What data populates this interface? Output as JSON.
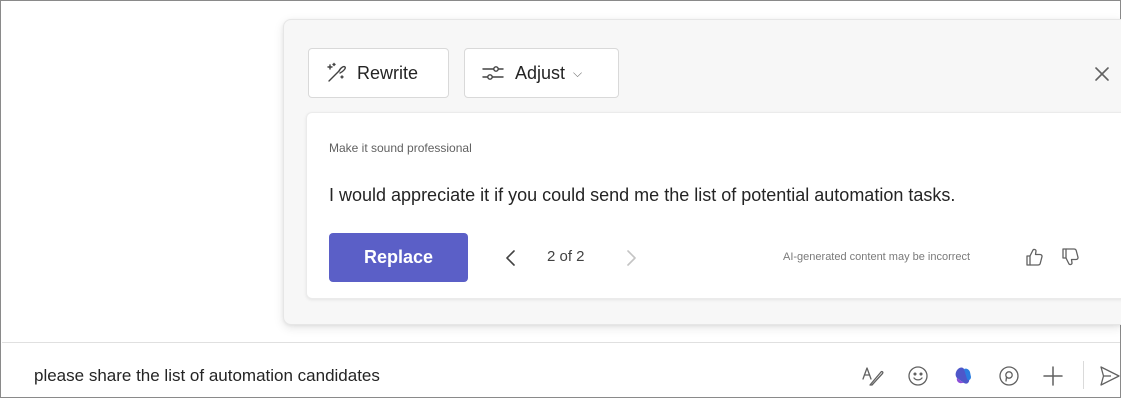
{
  "toolbar": {
    "rewrite_label": "Rewrite",
    "adjust_label": "Adjust",
    "adjust_chevron": "⌵"
  },
  "suggestion": {
    "prompt": "Make it sound professional",
    "text": "I would appreciate it if you could send me the list of potential automation tasks.",
    "replace_label": "Replace",
    "pager": "2 of 2",
    "disclaimer": "AI-generated content may be incorrect"
  },
  "compose": {
    "message": "please share the list of automation candidates"
  },
  "icons": [
    "rewrite-icon",
    "adjust-icon",
    "close-icon",
    "chevron-left-icon",
    "chevron-right-icon",
    "thumbs-up-icon",
    "thumbs-down-icon",
    "format-icon",
    "emoji-icon",
    "copilot-icon",
    "loop-icon",
    "plus-icon",
    "send-icon"
  ],
  "colors": {
    "accent": "#5b5fc7",
    "panel_bg": "#f7f7f7"
  }
}
